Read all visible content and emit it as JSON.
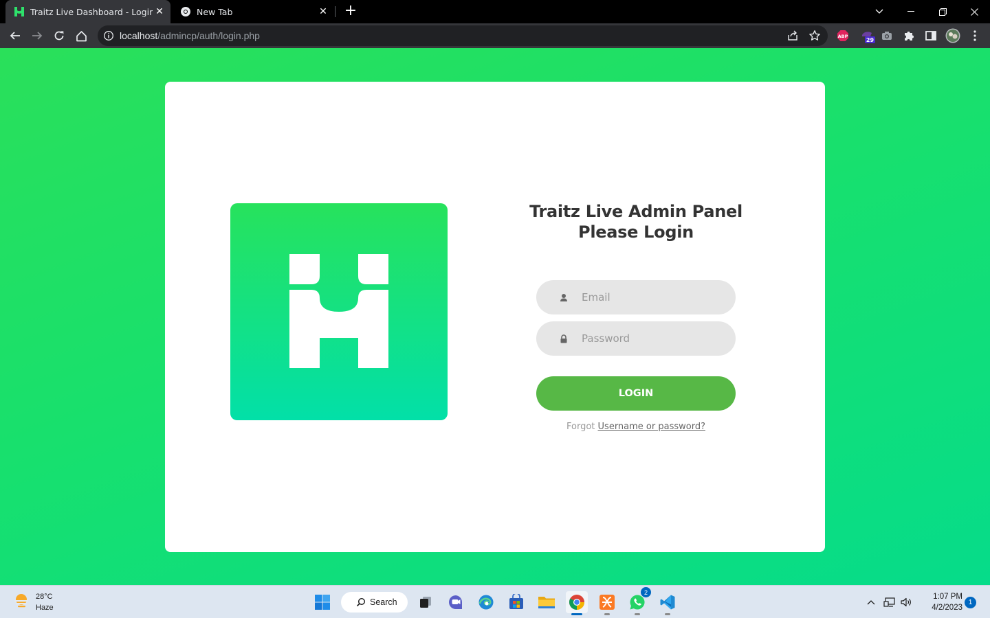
{
  "browser": {
    "tabs": [
      {
        "title": "Traitz Live Dashboard - Login",
        "active": true
      },
      {
        "title": "New Tab",
        "active": false
      }
    ],
    "url": {
      "host": "localhost",
      "path": "/admincp/auth/login.php"
    },
    "extensions": {
      "abp_label": "ABP",
      "badge_count": "29"
    }
  },
  "login": {
    "heading_line1": "Traitz Live Admin Panel",
    "heading_line2": "Please Login",
    "email_placeholder": "Email",
    "password_placeholder": "Password",
    "login_label": "LOGIN",
    "forgot_prefix": "Forgot",
    "forgot_link": "Username or password?"
  },
  "taskbar": {
    "weather": {
      "temp": "28°C",
      "condition": "Haze"
    },
    "search_label": "Search",
    "whatsapp_badge": "2",
    "time": "1:07 PM",
    "date": "4/2/2023",
    "notification_count": "1"
  },
  "colors": {
    "page_gradient_start": "#2ae05a",
    "page_gradient_end": "#06dc8a",
    "login_button": "#57b846",
    "field_bg": "#e6e6e6"
  }
}
